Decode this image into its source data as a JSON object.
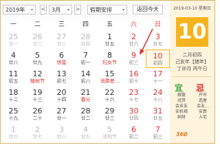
{
  "toolbar": {
    "year": "2019年",
    "month": "3月",
    "holiday": "假期安排",
    "today_button": "返回今天",
    "prev_arrow": "<",
    "next_arrow": ">",
    "caret": "▾"
  },
  "weekdays": [
    "一",
    "二",
    "三",
    "四",
    "五",
    "六",
    "日"
  ],
  "weeks": [
    [
      {
        "n": "25",
        "l": "廿一"
      },
      {
        "n": "26",
        "l": "廿二"
      },
      {
        "n": "27",
        "l": "廿三"
      },
      {
        "n": "28",
        "l": "廿四"
      },
      {
        "n": "1",
        "l": "廿五"
      },
      {
        "n": "2",
        "l": "廿六"
      },
      {
        "n": "3",
        "l": "廿七"
      }
    ],
    [
      {
        "n": "4",
        "l": "廿八"
      },
      {
        "n": "5",
        "l": "廿九"
      },
      {
        "n": "6",
        "l": "惊蛰"
      },
      {
        "n": "7",
        "l": "初一"
      },
      {
        "n": "8",
        "l": "妇女节"
      },
      {
        "n": "9",
        "l": "初三"
      },
      {
        "n": "10",
        "l": "初四"
      }
    ],
    [
      {
        "n": "11",
        "l": "初五"
      },
      {
        "n": "12",
        "l": "植树节"
      },
      {
        "n": "13",
        "l": "初七"
      },
      {
        "n": "14",
        "l": "初八"
      },
      {
        "n": "15",
        "l": "消费者..."
      },
      {
        "n": "16",
        "l": "初十"
      },
      {
        "n": "17",
        "l": "十一"
      }
    ],
    [
      {
        "n": "18",
        "l": "十二"
      },
      {
        "n": "19",
        "l": "十三"
      },
      {
        "n": "20",
        "l": "十四"
      },
      {
        "n": "21",
        "l": "春分"
      },
      {
        "n": "22",
        "l": "十六"
      },
      {
        "n": "23",
        "l": "十七"
      },
      {
        "n": "24",
        "l": "十八"
      }
    ],
    [
      {
        "n": "25",
        "l": "十九"
      },
      {
        "n": "26",
        "l": "二十"
      },
      {
        "n": "27",
        "l": "廿一"
      },
      {
        "n": "28",
        "l": "廿二"
      },
      {
        "n": "29",
        "l": "廿三"
      },
      {
        "n": "30",
        "l": "廿四"
      },
      {
        "n": "31",
        "l": "廿五"
      }
    ],
    [
      {
        "n": "1",
        "l": "廿六"
      },
      {
        "n": "2",
        "l": "廿七"
      },
      {
        "n": "3",
        "l": "廿八"
      },
      {
        "n": "4",
        "l": "廿九"
      },
      {
        "n": "5",
        "l": "清明节"
      },
      {
        "n": "6",
        "l": "初二"
      },
      {
        "n": "7",
        "l": "初三"
      }
    ]
  ],
  "side": {
    "date_line": "2019-03-10 星期日",
    "big_day": "10",
    "lunar_date": "二月初四",
    "ganzhi_year": "己亥年【猪年】",
    "ganzhi_month_day": "丁卯月 丙午日",
    "yi_label": "宜",
    "ji_label": "忌",
    "yi_items": [
      "嫁娶",
      "冠笄",
      "会亲友",
      "安机械",
      "纳财"
    ],
    "ji_items": [
      "开市",
      "造屋",
      "会友...",
      "安葬",
      "入宅"
    ]
  },
  "watermark": "360",
  "colors": {
    "accent": "#f5b41e",
    "weekend_red": "#e03030",
    "side_bg": "#fef4de",
    "frame": "#d9b66a"
  }
}
